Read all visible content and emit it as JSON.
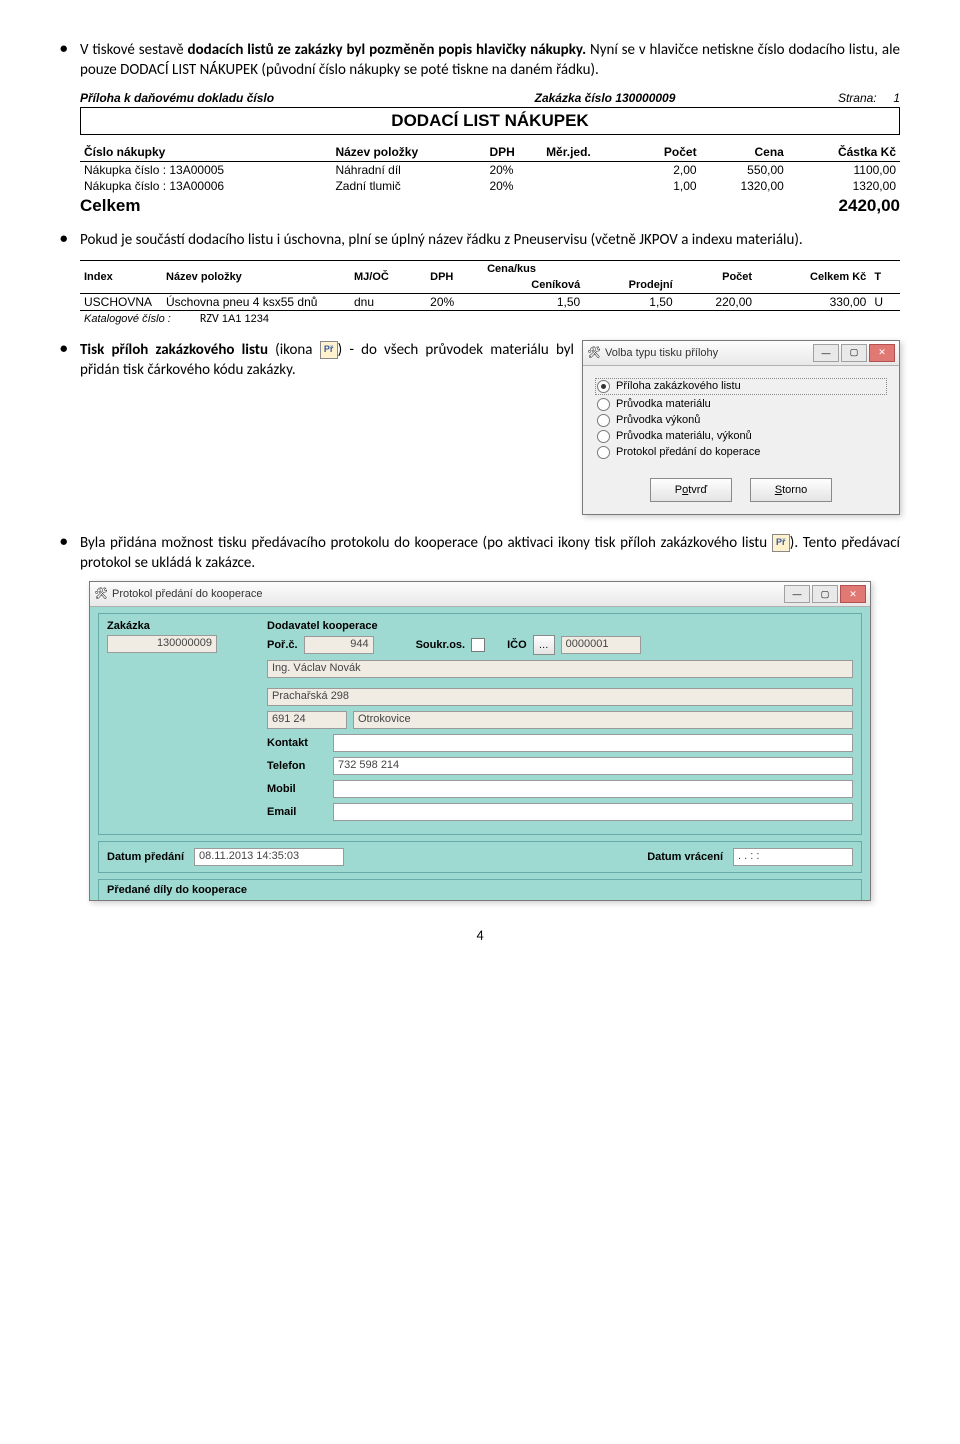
{
  "bullets": {
    "b1a": "V tiskové sestavě ",
    "b1b": "dodacích listů ze zakázky byl pozměněn popis hlavičky nákupky.",
    "b1c": " Nyní se v hlavičce netiskne číslo dodacího listu, ale pouze DODACÍ LIST NÁKUPEK (původní číslo nákupky se poté tiskne na daném řádku).",
    "b2": "Pokud je součástí dodacího listu i úschovna, plní se úplný název řádku z Pneuservisu (včetně JKPOV a indexu materiálu).",
    "b3a": "Tisk příloh zakázkového listu",
    "b3b": " (ikona ",
    "b3c": ") - do všech průvodek materiálu byl přidán tisk čárkového kódu zakázky.",
    "b4a": "Byla přidána možnost tisku předávacího protokolu do kooperace (po aktivaci ikony tisk příloh zakázkového listu ",
    "b4b": "). Tento předávací protokol se ukládá k zakázce."
  },
  "icon_label": "Př",
  "preview1": {
    "top_left": "Příloha k daňovému dokladu číslo",
    "top_mid": "Zakázka číslo 130000009",
    "top_right_lbl": "Strana:",
    "top_right_val": "1",
    "title": "DODACÍ LIST NÁKUPEK",
    "headers": [
      "Číslo nákupky",
      "Název položky",
      "DPH",
      "Měr.jed.",
      "Počet",
      "Cena",
      "Částka Kč"
    ],
    "rows": [
      {
        "c0": "Nákupka číslo : 13A00005",
        "c1": "Náhradní díl",
        "c2": "20%",
        "c3": "",
        "c4": "2,00",
        "c5": "550,00",
        "c6": "1100,00"
      },
      {
        "c0": "Nákupka číslo : 13A00006",
        "c1": "Zadní tlumič",
        "c2": "20%",
        "c3": "",
        "c4": "1,00",
        "c5": "1320,00",
        "c6": "1320,00"
      }
    ],
    "total_lbl": "Celkem",
    "total_val": "2420,00"
  },
  "preview2": {
    "cenakus": "Cena/kus",
    "headers": [
      "Index",
      "Název položky",
      "MJ/OČ",
      "DPH",
      "Ceníková",
      "Prodejní",
      "Počet",
      "Celkem Kč",
      "T"
    ],
    "row": {
      "c0": "USCHOVNA",
      "c1": "Úschovna pneu 4 ksx55 dnů",
      "c2": "dnu",
      "c3": "20%",
      "c4": "1,50",
      "c5": "1,50",
      "c6": "220,00",
      "c7": "330,00",
      "c8": "U"
    },
    "sub_lbl": "Katalogové číslo :",
    "sub_rzv": "RZV",
    "sub_val": "1A1 1234"
  },
  "dialog1": {
    "title": "Volba typu tisku přílohy",
    "options": [
      "Příloha zakázkového listu",
      "Průvodka materiálu",
      "Průvodka výkonů",
      "Průvodka materiálu, výkonů",
      "Protokol předání do koperace"
    ],
    "btn_confirm_pre": "P",
    "btn_confirm_u": "o",
    "btn_confirm_post": "tvrď",
    "btn_cancel_u": "S",
    "btn_cancel_post": "torno"
  },
  "dialog2": {
    "title": "Protokol předání do kooperace",
    "zakazka_lbl": "Zakázka",
    "zakazka_val": "130000009",
    "dodavatel_lbl": "Dodavatel kooperace",
    "porc_lbl": "Poř.č.",
    "porc_val": "944",
    "soukr_lbl": "Soukr.os.",
    "ico_lbl": "IČO",
    "ico_val": "0000001",
    "name_val": "Ing. Václav Novák",
    "street_val": "Prachařská 298",
    "zip_val": "691 24",
    "city_val": "Otrokovice",
    "kontakt_lbl": "Kontakt",
    "telefon_lbl": "Telefon",
    "telefon_val": "732 598 214",
    "mobil_lbl": "Mobil",
    "email_lbl": "Email",
    "datum_predani_lbl": "Datum předání",
    "datum_predani_val": "08.11.2013 14:35:03",
    "datum_vraceni_lbl": "Datum vrácení",
    "datum_vraceni_val": " .  .        :  :",
    "predane_lbl": "Předané díly do kooperace"
  },
  "page_number": "4"
}
